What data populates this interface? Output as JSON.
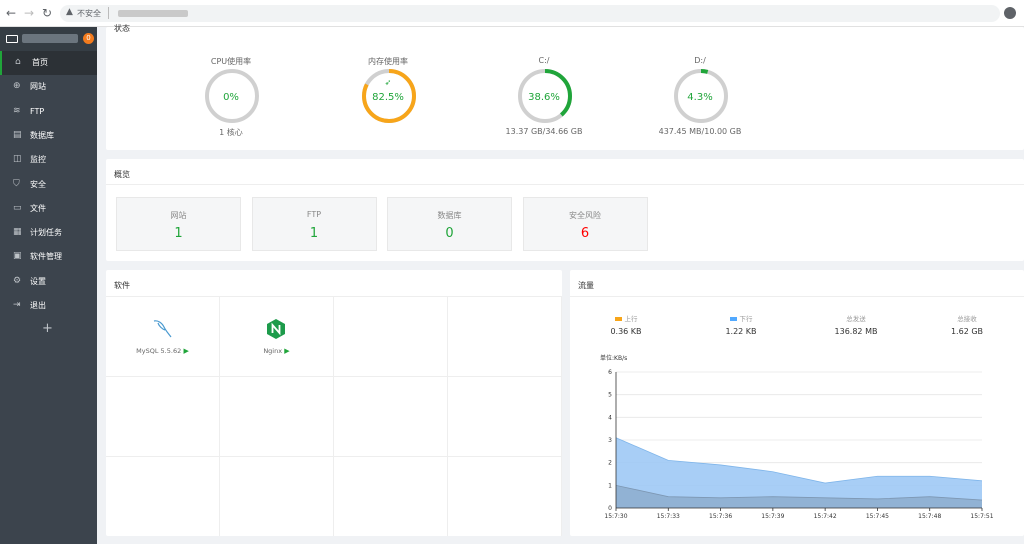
{
  "browser": {
    "security_label": "不安全"
  },
  "sidebar": {
    "badge": "0",
    "items": [
      {
        "label": "首页",
        "icon": "home-icon",
        "glyph": "⌂"
      },
      {
        "label": "网站",
        "icon": "globe-icon",
        "glyph": "⊕"
      },
      {
        "label": "FTP",
        "icon": "ftp-icon",
        "glyph": "≋"
      },
      {
        "label": "数据库",
        "icon": "database-icon",
        "glyph": "▤"
      },
      {
        "label": "监控",
        "icon": "monitor-icon",
        "glyph": "◫"
      },
      {
        "label": "安全",
        "icon": "shield-icon",
        "glyph": "⛉"
      },
      {
        "label": "文件",
        "icon": "folder-icon",
        "glyph": "▭"
      },
      {
        "label": "计划任务",
        "icon": "calendar-icon",
        "glyph": "▦"
      },
      {
        "label": "软件管理",
        "icon": "apps-icon",
        "glyph": "▣"
      },
      {
        "label": "设置",
        "icon": "gear-icon",
        "glyph": "⚙"
      },
      {
        "label": "退出",
        "icon": "logout-icon",
        "glyph": "⇥"
      }
    ],
    "add": "+"
  },
  "status": {
    "title": "状态",
    "gauges": [
      {
        "label": "CPU使用率",
        "value": "0%",
        "percent": 0,
        "color": "#20a53a",
        "sub": "1 核心"
      },
      {
        "label": "内存使用率",
        "value": "82.5%",
        "percent": 82.5,
        "color": "#f7a51a",
        "sub": "",
        "rocket": "🚀"
      },
      {
        "label": "C:/",
        "value": "38.6%",
        "percent": 38.6,
        "color": "#20a53a",
        "sub": "13.37 GB/34.66 GB"
      },
      {
        "label": "D:/",
        "value": "4.3%",
        "percent": 4.3,
        "color": "#20a53a",
        "sub": "437.45 MB/10.00 GB"
      }
    ]
  },
  "overview": {
    "title": "概览",
    "cards": [
      {
        "label": "网站",
        "value": "1",
        "danger": false
      },
      {
        "label": "FTP",
        "value": "1",
        "danger": false
      },
      {
        "label": "数据库",
        "value": "0",
        "danger": false
      },
      {
        "label": "安全风险",
        "value": "6",
        "danger": true
      }
    ]
  },
  "software": {
    "title": "软件",
    "items": [
      {
        "name": "MySQL 5.5.62",
        "icon": "mysql-dolphin-icon"
      },
      {
        "name": "Nginx",
        "icon": "nginx-icon"
      }
    ]
  },
  "traffic": {
    "title": "流量",
    "stats": [
      {
        "label": "上行",
        "value": "0.36 KB",
        "color": "#f7a51a"
      },
      {
        "label": "下行",
        "value": "1.22 KB",
        "color": "#52a9ff"
      },
      {
        "label": "总发送",
        "value": "136.82 MB"
      },
      {
        "label": "总接收",
        "value": "1.62 GB"
      }
    ]
  },
  "chart_data": {
    "type": "area",
    "ylabel": "单位:KB/s",
    "ylim": [
      0,
      6
    ],
    "yticks": [
      0,
      1,
      2,
      3,
      4,
      5,
      6
    ],
    "x": [
      "15:7:30",
      "15:7:33",
      "15:7:36",
      "15:7:39",
      "15:7:42",
      "15:7:45",
      "15:7:48",
      "15:7:51"
    ],
    "series": [
      {
        "name": "下行",
        "color": "#9ec9f5",
        "values": [
          3.1,
          2.1,
          1.9,
          1.6,
          1.1,
          1.4,
          1.4,
          1.2
        ]
      },
      {
        "name": "上行",
        "color": "#8aa8c8",
        "values": [
          1.0,
          0.5,
          0.45,
          0.5,
          0.45,
          0.4,
          0.5,
          0.35
        ]
      }
    ]
  }
}
